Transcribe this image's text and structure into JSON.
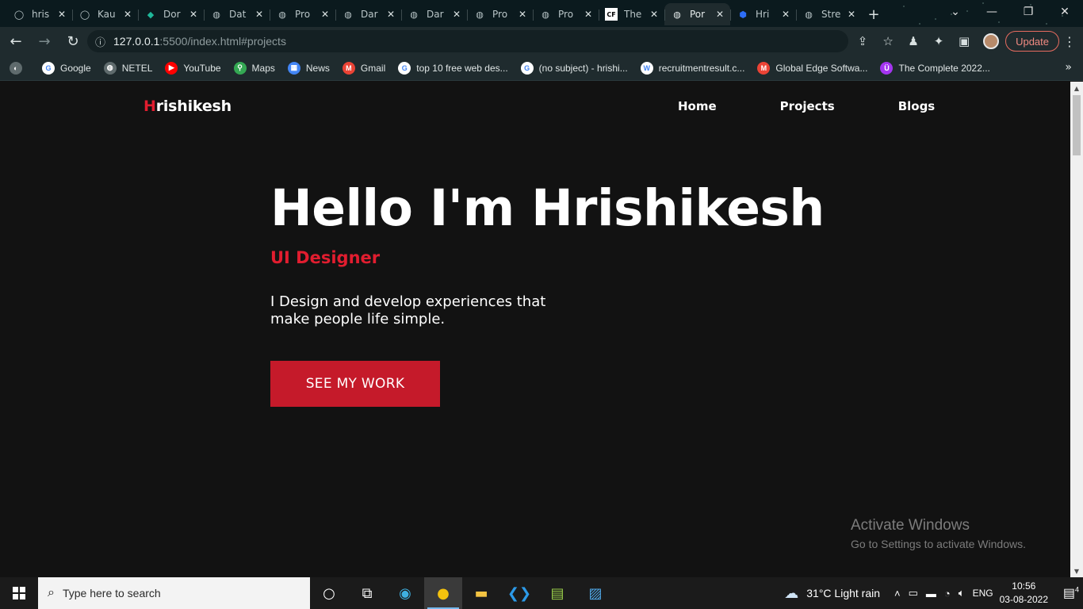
{
  "browser": {
    "tabs": [
      {
        "label": "hris",
        "icon": "github-icon"
      },
      {
        "label": "Kau",
        "icon": "github-icon"
      },
      {
        "label": "Dor",
        "icon": "diamond-icon"
      },
      {
        "label": "Dat",
        "icon": "globe-icon"
      },
      {
        "label": "Pro",
        "icon": "globe-icon"
      },
      {
        "label": "Dar",
        "icon": "globe-icon"
      },
      {
        "label": "Dar",
        "icon": "globe-icon"
      },
      {
        "label": "Pro",
        "icon": "globe-icon"
      },
      {
        "label": "Pro",
        "icon": "globe-icon"
      },
      {
        "label": "The",
        "icon": "cf-icon"
      },
      {
        "label": "Por",
        "icon": "globe-icon",
        "active": true
      },
      {
        "label": "Hri",
        "icon": "blue-hex-icon"
      },
      {
        "label": "Stre",
        "icon": "globe-icon"
      }
    ],
    "url_host": "127.0.0.1",
    "url_rest": ":5500/index.html#projects",
    "update_label": "Update",
    "bookmarks": [
      {
        "label": "Google",
        "icon": "google-icon",
        "color": "#ffffff"
      },
      {
        "label": "NETEL",
        "icon": "globe-icon",
        "color": "#5f6b6d"
      },
      {
        "label": "YouTube",
        "icon": "youtube-icon",
        "color": "#ff0000"
      },
      {
        "label": "Maps",
        "icon": "maps-icon",
        "color": "#34a853"
      },
      {
        "label": "News",
        "icon": "news-icon",
        "color": "#4285f4"
      },
      {
        "label": "Gmail",
        "icon": "gmail-icon",
        "color": "#ea4335"
      },
      {
        "label": "top 10 free web des...",
        "icon": "google-icon",
        "color": "#ffffff"
      },
      {
        "label": "(no subject) - hrishi...",
        "icon": "google-icon",
        "color": "#ffffff"
      },
      {
        "label": "recruitmentresult.c...",
        "icon": "wordpress-icon",
        "color": "#ffffff"
      },
      {
        "label": "Global Edge Softwa...",
        "icon": "gmail-icon",
        "color": "#ea4335"
      },
      {
        "label": "The Complete 2022...",
        "icon": "udemy-icon",
        "color": "#a435f0"
      }
    ]
  },
  "site": {
    "logo_first": "H",
    "logo_rest": "rishikesh",
    "nav": [
      "Home",
      "Projects",
      "Blogs"
    ],
    "hero_title": "Hello I'm Hrishikesh",
    "hero_subtitle": "UI Designer",
    "hero_description": "I Design and develop experiences that make people life simple.",
    "cta_label": "SEE MY WORK",
    "accent_color": "#e11d2f"
  },
  "watermark": {
    "line1": "Activate Windows",
    "line2": "Go to Settings to activate Windows."
  },
  "taskbar": {
    "search_placeholder": "Type here to search",
    "weather": "31°C  Light rain",
    "language": "ENG",
    "time": "10:56",
    "date": "03-08-2022",
    "notification_count": "4"
  }
}
